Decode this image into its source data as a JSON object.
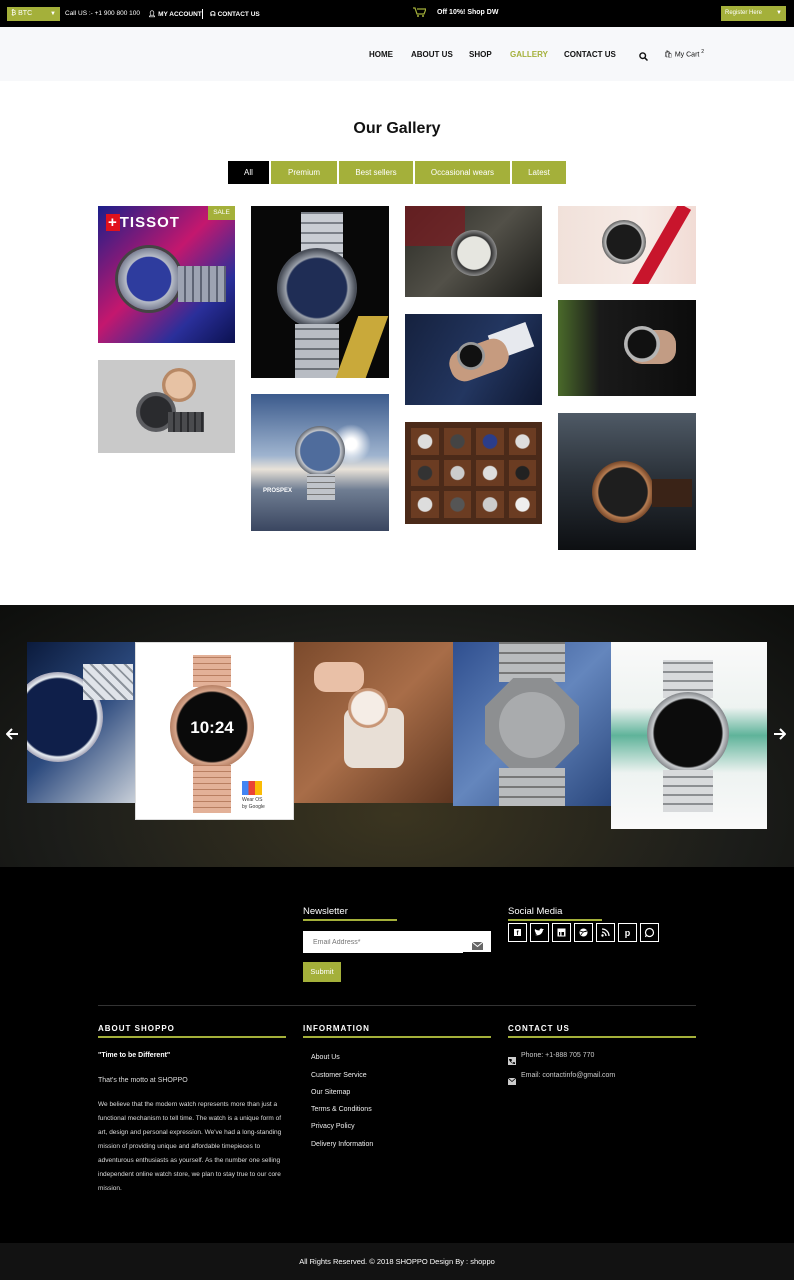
{
  "topbar": {
    "currency": "BTC",
    "phone": "Call US :- +1 900 800 100",
    "account": "MY ACCOUNT",
    "contact": "CONTACT US",
    "promo": "Off 10%! Shop DW",
    "register": "Register Here"
  },
  "nav": {
    "items": [
      "HOME",
      "ABOUT US",
      "SHOP",
      "GALLERY",
      "CONTACT US"
    ],
    "active": "GALLERY",
    "cart_label": "My Cart",
    "cart_count": "2"
  },
  "gallery": {
    "title": "Our Gallery",
    "tabs": [
      "All",
      "Premium",
      "Best sellers",
      "Occasional wears",
      "Latest"
    ],
    "active_tab": "All",
    "sale_badge": "SALE",
    "tissot_text": "TISSOT",
    "prospex_text": "PROSPEX"
  },
  "carousel": {
    "watch_time": "10:24",
    "wear_os": "Wear OS",
    "by_google": "by Google"
  },
  "footer": {
    "newsletter": {
      "heading": "Newsletter",
      "placeholder": "Email Address*",
      "submit": "Submit"
    },
    "social": {
      "heading": "Social Media",
      "icons": [
        "facebook-icon",
        "twitter-icon",
        "linkedin-icon",
        "dribbble-icon",
        "rss-icon",
        "pinterest-icon",
        "whatsapp-icon"
      ]
    },
    "about": {
      "heading": "ABOUT SHOPPO",
      "tagline": "\"Time to be Different\"",
      "motto": "That's the motto at SHOPPO",
      "body": "We believe that the modern watch represents more than just a functional mechanism to tell time. The watch is a unique form of art, design and personal expression. We've had a long-standing mission of providing unique and affordable timepieces to adventurous enthusiasts as yourself. As the number one selling independent online watch store, we plan to stay true to our core mission."
    },
    "information": {
      "heading": "INFORMATION",
      "links": [
        "About Us",
        "Customer Service",
        "Our Sitemap",
        "Terms & Conditions",
        "Privacy Policy",
        "Delivery Information"
      ]
    },
    "contact": {
      "heading": "CONTACT US",
      "phone": "Phone: +1-888 705 770",
      "email": "Email: contactinfo@gmail.com"
    }
  },
  "copyright": "All Rights Reserved. © 2018 SHOPPO Design By : shoppo",
  "colors": {
    "accent": "#a4b03a",
    "dark": "#000000"
  }
}
